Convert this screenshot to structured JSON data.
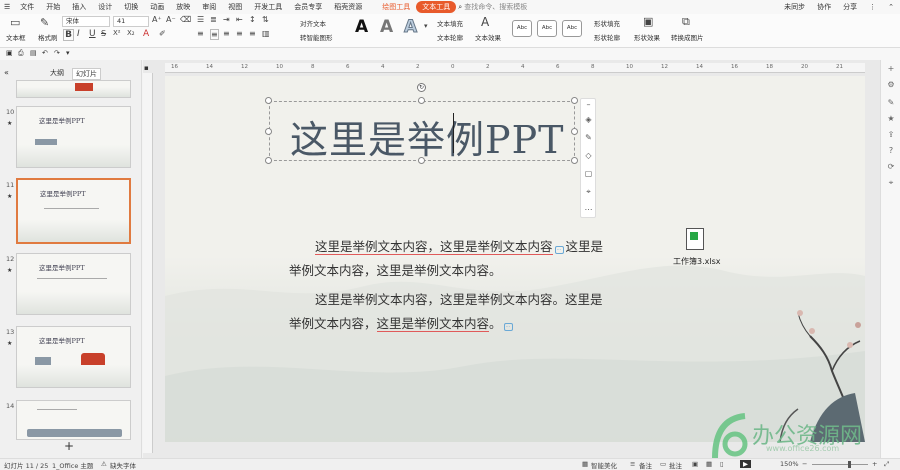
{
  "menubar": {
    "items": [
      "文件",
      "开始",
      "插入",
      "设计",
      "切换",
      "动画",
      "放映",
      "审阅",
      "视图",
      "开发工具",
      "会员专享",
      "稻壳资源"
    ],
    "context_tabs": [
      "绘图工具",
      "文本工具"
    ],
    "search_placeholder": "查找命令、搜索模板",
    "right": [
      "未同步",
      "协作",
      "分享"
    ]
  },
  "ribbon": {
    "textbox": "文本框",
    "format_painter": "格式刷",
    "font_name": "宋体",
    "font_size": "41",
    "text_align": "对齐文本",
    "smart_shape": "转智能图形",
    "text_fill": "文本填充",
    "text_outline": "文本轮廓",
    "text_effect": "文本效果",
    "style_sample": "Abc",
    "shape_fill": "形状填充",
    "shape_outline": "形状轮廓",
    "shape_effect": "形状效果",
    "convert_image": "转换成图片"
  },
  "leftpanel": {
    "tabs": [
      "大纲",
      "幻灯片"
    ],
    "thumbs": [
      {
        "num": "10",
        "title": "这里是举例PPT"
      },
      {
        "num": "11",
        "title": "这里是举例PPT"
      },
      {
        "num": "12",
        "title": "这里是举例PPT"
      },
      {
        "num": "13",
        "title": "这里是举例PPT"
      },
      {
        "num": "14",
        "title": ""
      }
    ]
  },
  "ruler": {
    "h_ticks": [
      "16",
      "14",
      "12",
      "10",
      "8",
      "6",
      "4",
      "2",
      "0",
      "2",
      "4",
      "6",
      "8",
      "10",
      "12",
      "14",
      "16",
      "18",
      "20",
      "21"
    ]
  },
  "slide": {
    "title": "这里是举例PPT",
    "para1_l1": "这里是举例文本内容，这里是举例文本内容",
    "para1_l1b": "这里是",
    "para1_l2": "举例文本内容，这里是举例文本内容。",
    "para2_l1": "这里是举例文本内容，这里是举例文本内容。这里是",
    "para2_l2a": "举例文本内容，",
    "para2_l2b": "这里是举例文本内容",
    "para2_l2c": "。",
    "file_label": "工作簿3.xlsx"
  },
  "status": {
    "slide_pos": "幻灯片 11 / 25",
    "theme": "1_Office 主题",
    "missing_font": "缺失字体",
    "beautify": "智能美化",
    "notes": "备注",
    "comment": "批注",
    "zoom": "150%"
  },
  "watermark": "www.office26.com",
  "watermark_brand": "办公资源网"
}
